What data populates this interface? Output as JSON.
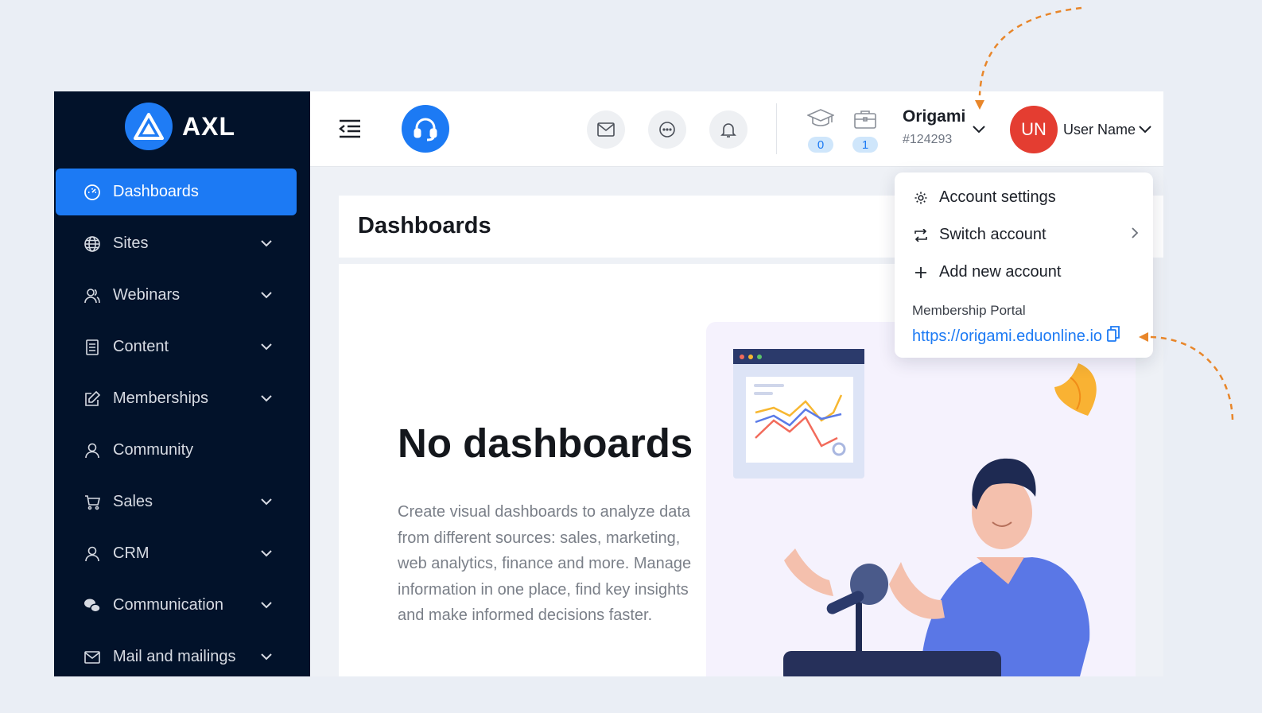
{
  "brand": {
    "name": "AXL"
  },
  "sidebar": {
    "items": [
      {
        "label": "Dashboards",
        "icon": "gauge-icon",
        "active": true,
        "has_children": false
      },
      {
        "label": "Sites",
        "icon": "globe-icon",
        "has_children": true
      },
      {
        "label": "Webinars",
        "icon": "users-icon",
        "has_children": true
      },
      {
        "label": "Content",
        "icon": "document-icon",
        "has_children": true
      },
      {
        "label": "Memberships",
        "icon": "edit-icon",
        "has_children": true
      },
      {
        "label": "Community",
        "icon": "user-icon",
        "has_children": false
      },
      {
        "label": "Sales",
        "icon": "cart-icon",
        "has_children": true
      },
      {
        "label": "CRM",
        "icon": "user-icon",
        "has_children": true
      },
      {
        "label": "Communication",
        "icon": "chat-bubbles-icon",
        "has_children": true
      },
      {
        "label": "Mail and mailings",
        "icon": "mail-icon",
        "has_children": true
      }
    ]
  },
  "topbar": {
    "courses_count": "0",
    "orders_count": "1",
    "account_name": "Origami",
    "account_id": "#124293",
    "avatar_initials": "UN",
    "user_name": "User Name"
  },
  "page": {
    "title": "Dashboards",
    "empty_title": "No dashboards",
    "empty_description": "Create visual dashboards to analyze data from different sources: sales, marketing, web analytics, finance and more. Manage information in one place, find key insights and make informed decisions faster."
  },
  "account_menu": {
    "items": [
      {
        "label": "Account settings",
        "icon": "gear-icon"
      },
      {
        "label": "Switch account",
        "icon": "switch-icon"
      },
      {
        "label": "Add new account",
        "icon": "plus-icon"
      }
    ],
    "portal_label": "Membership Portal",
    "portal_url": "https://origami.eduonline.io"
  },
  "colors": {
    "accent": "#1c7af4",
    "sidebar_bg": "#02122a",
    "avatar_bg": "#e43d31",
    "annotation": "#e8862a"
  }
}
